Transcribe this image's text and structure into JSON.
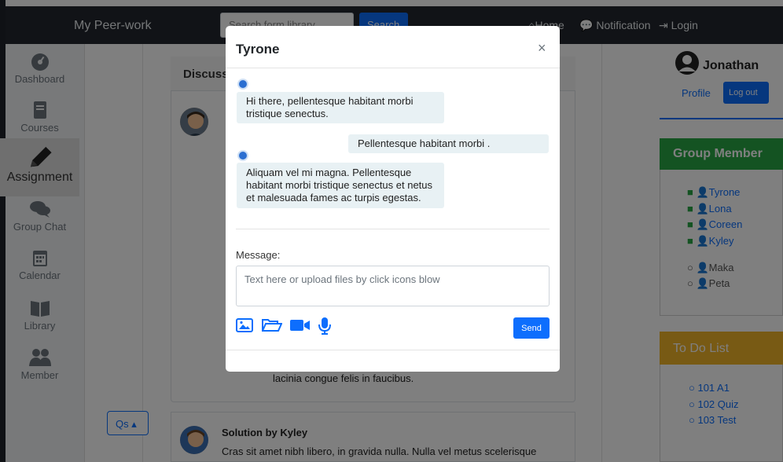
{
  "navbar": {
    "brand": "My Peer-work",
    "search_placeholder": "Search form library",
    "search_button": "Search",
    "home": "Home",
    "notification": "Notification",
    "login": "Login"
  },
  "sidebar": {
    "items": [
      {
        "label": "Dashboard",
        "icon": "dashboard-icon"
      },
      {
        "label": "Courses",
        "icon": "book-icon"
      },
      {
        "label": "Assignment",
        "icon": "pencil-icon"
      },
      {
        "label": "Group Chat",
        "icon": "chat-icon"
      },
      {
        "label": "Calendar",
        "icon": "calendar-icon"
      },
      {
        "label": "Library",
        "icon": "open-book-icon"
      },
      {
        "label": "Member",
        "icon": "users-icon"
      }
    ]
  },
  "main": {
    "card_title": "Discuss",
    "post_text_tail": "lacinia congue felis in faucibus.",
    "qs_button": "Qs",
    "solution_title": "Solution by Kyley",
    "solution_text": "Cras sit amet nibh libero, in gravida nulla. Nulla vel metus scelerisque"
  },
  "profile": {
    "name": "Jonathan",
    "profile_link": "Profile",
    "logout": "Log out"
  },
  "group_member": {
    "title": "Group Member",
    "online": [
      "Tyrone",
      "Lona",
      "Coreen",
      "Kyley"
    ],
    "offline": [
      "Maka",
      "Peta"
    ]
  },
  "todo": {
    "title": "To Do List",
    "items": [
      "101 A1",
      "102 Quiz",
      "103 Test"
    ]
  },
  "modal": {
    "title": "Tyrone",
    "close": "×",
    "messages": [
      {
        "from": "other",
        "text": "Hi there, pellentesque habitant morbi tristique senectus."
      },
      {
        "from": "self",
        "text": "Pellentesque habitant morbi ."
      },
      {
        "from": "other",
        "text": "Aliquam vel mi magna. Pellentesque habitant morbi tristique senectus et netus et malesuada fames ac turpis egestas."
      }
    ],
    "message_label": "Message:",
    "message_placeholder": "Text here or upload files by click icons blow",
    "send": "Send",
    "tools": [
      "image-icon",
      "folder-icon",
      "video-icon",
      "microphone-icon"
    ]
  },
  "colors": {
    "primary": "#0d6efd",
    "group_header": "#28a745",
    "todo_header": "#f0b429",
    "navbar": "#22272e"
  }
}
